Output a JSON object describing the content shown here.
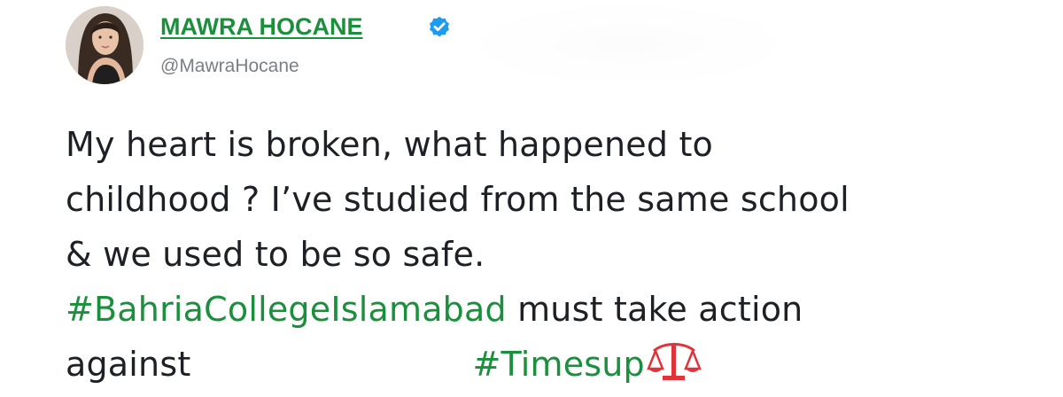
{
  "colors": {
    "accent": "#1a8f3c",
    "verified_badge": "#1d9bf0",
    "text": "#1d2025",
    "handle": "#7a7f84",
    "emoji": "#e0333b"
  },
  "author": {
    "name": "MAWRA HOCANE",
    "handle": "@MawraHocane",
    "verified_icon": "verified-badge-icon"
  },
  "tweet": {
    "line1": "My heart is broken, what happened to",
    "line2": "childhood ? I’ve studied from the same school",
    "line3": "& we used to be so safe.",
    "line4_hashtag": "#BahriaCollegeIslamabad",
    "line4_text": " must take action",
    "line5_text": "against",
    "line5_hashtag": "#Timesup",
    "emoji_icon": "scales-emoji-icon"
  }
}
